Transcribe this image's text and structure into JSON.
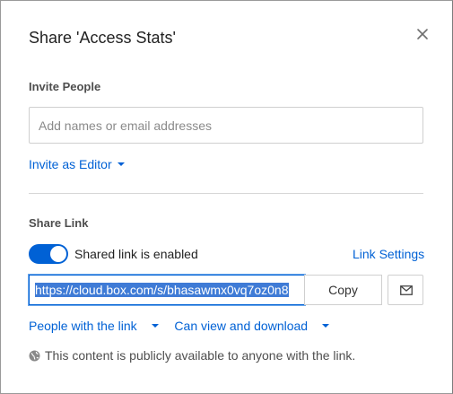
{
  "dialog": {
    "title": "Share 'Access Stats'",
    "close_icon": "close-icon"
  },
  "invite": {
    "section_label": "Invite People",
    "placeholder": "Add names or email addresses",
    "value": "",
    "role_label": "Invite as Editor"
  },
  "share_link": {
    "section_label": "Share Link",
    "toggle_enabled": true,
    "toggle_label": "Shared link is enabled",
    "settings_label": "Link Settings",
    "url": "https://cloud.box.com/s/bhasawmx0vq7oz0n8",
    "copy_label": "Copy",
    "email_icon": "envelope-icon",
    "access_label": "People with the link",
    "permission_label": "Can view and download",
    "notice": "This content is publicly available to anyone with the link.",
    "notice_icon": "globe-icon"
  },
  "colors": {
    "accent": "#0061d5",
    "selection": "#3f7bd6"
  }
}
